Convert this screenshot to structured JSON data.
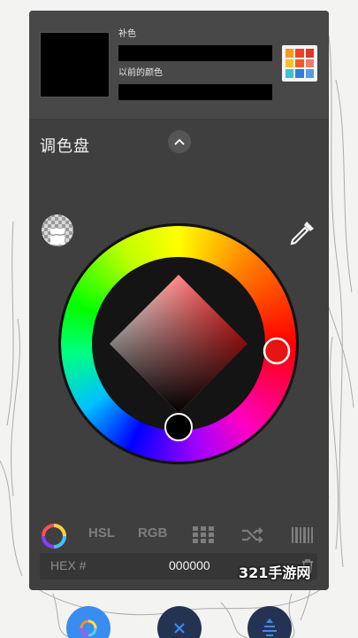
{
  "header": {
    "complementary_label": "补色",
    "previous_color_label": "以前的颜色"
  },
  "palette": {
    "title": "调色盘",
    "colors": [
      "#f39a24",
      "#e8432a",
      "#d9362c",
      "#f6c02b",
      "#e95c2b",
      "#ee7b6e",
      "#3fbfd0",
      "#2e7fd9",
      "#5a9be0"
    ]
  },
  "current_color": "#000000",
  "wheel": {
    "selected_hue": "#e81313"
  },
  "modes": {
    "hsl": "HSL",
    "rgb": "RGB"
  },
  "hex": {
    "label": "HEX #",
    "value": "000000"
  },
  "watermark": "321手游网",
  "colors": {
    "panel": "#3f3f3f",
    "accent_blue": "#2f7fe0",
    "button_dark": "#2c3e63"
  }
}
